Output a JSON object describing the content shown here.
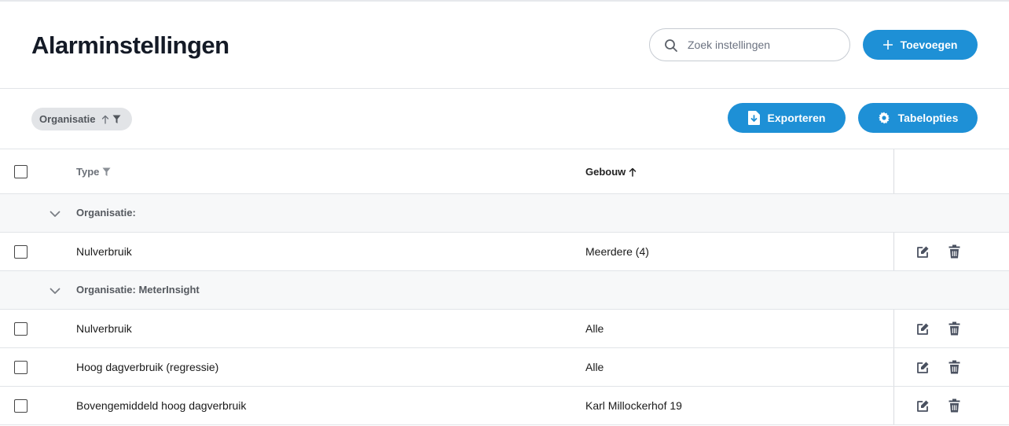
{
  "header": {
    "title": "Alarminstellingen",
    "search_placeholder": "Zoek instellingen",
    "add_label": "Toevoegen"
  },
  "toolbar": {
    "filter_chip_label": "Organisatie",
    "export_label": "Exporteren",
    "options_label": "Tabelopties"
  },
  "table": {
    "columns": {
      "type": "Type",
      "building": "Gebouw"
    },
    "groups": [
      {
        "label": "Organisatie:",
        "rows": [
          {
            "type": "Nulverbruik",
            "building": "Meerdere (4)"
          }
        ]
      },
      {
        "label": "Organisatie: MeterInsight",
        "rows": [
          {
            "type": "Nulverbruik",
            "building": "Alle"
          },
          {
            "type": "Hoog dagverbruik (regressie)",
            "building": "Alle"
          },
          {
            "type": "Bovengemiddeld hoog dagverbruik",
            "building": "Karl Millockerhof 19"
          }
        ]
      }
    ]
  },
  "icons": {
    "search": "search-icon",
    "add": "plus-icon",
    "export": "file-download-icon",
    "options": "gear-icon",
    "sort_asc": "arrow-up-icon",
    "filter": "funnel-icon",
    "collapse": "chevron-down-icon",
    "edit": "edit-icon",
    "delete": "trash-icon"
  },
  "colors": {
    "primary": "#1e90d6",
    "title": "#141a26",
    "border": "#e1e4e8",
    "chip_bg": "#e2e4e7"
  }
}
